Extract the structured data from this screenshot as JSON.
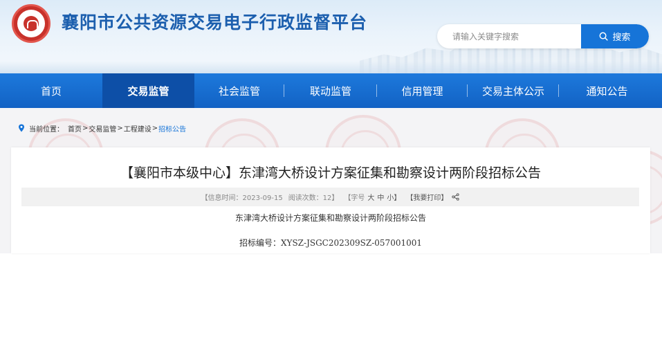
{
  "header": {
    "site_title": "襄阳市公共资源交易电子行政监督平台",
    "logo_icon": "city-emblem-logo",
    "search": {
      "placeholder": "请输入关键字搜索",
      "button_label": "搜索",
      "button_icon": "search-icon"
    }
  },
  "nav": {
    "items": [
      {
        "label": "首页"
      },
      {
        "label": "交易监管",
        "active": true
      },
      {
        "label": "社会监管"
      },
      {
        "label": "联动监管"
      },
      {
        "label": "信用管理"
      },
      {
        "label": "交易主体公示"
      },
      {
        "label": "通知公告"
      }
    ]
  },
  "breadcrumb": {
    "label": "当前位置：",
    "items": [
      "首页",
      "交易监管",
      "工程建设",
      "招标公告"
    ]
  },
  "article": {
    "title": "【襄阳市本级中心】东津湾大桥设计方案征集和勘察设计两阶段招标公告",
    "meta": {
      "info_time": "【信息时间：2023-09-15",
      "views": "阅读次数：12】",
      "font_size_label": "【字号",
      "size_large": "大",
      "size_medium": "中",
      "size_small": "小】",
      "print": "【我要打印】"
    },
    "body": {
      "heading": "东津湾大桥设计方案征集和勘察设计两阶段招标公告",
      "tender_no": "招标编号：XYSZ-JSGC202309SZ-057001001"
    }
  },
  "colors": {
    "brand_blue": "#1674d8",
    "nav_active": "#0d4fa7",
    "title_blue": "#1c5fae"
  }
}
